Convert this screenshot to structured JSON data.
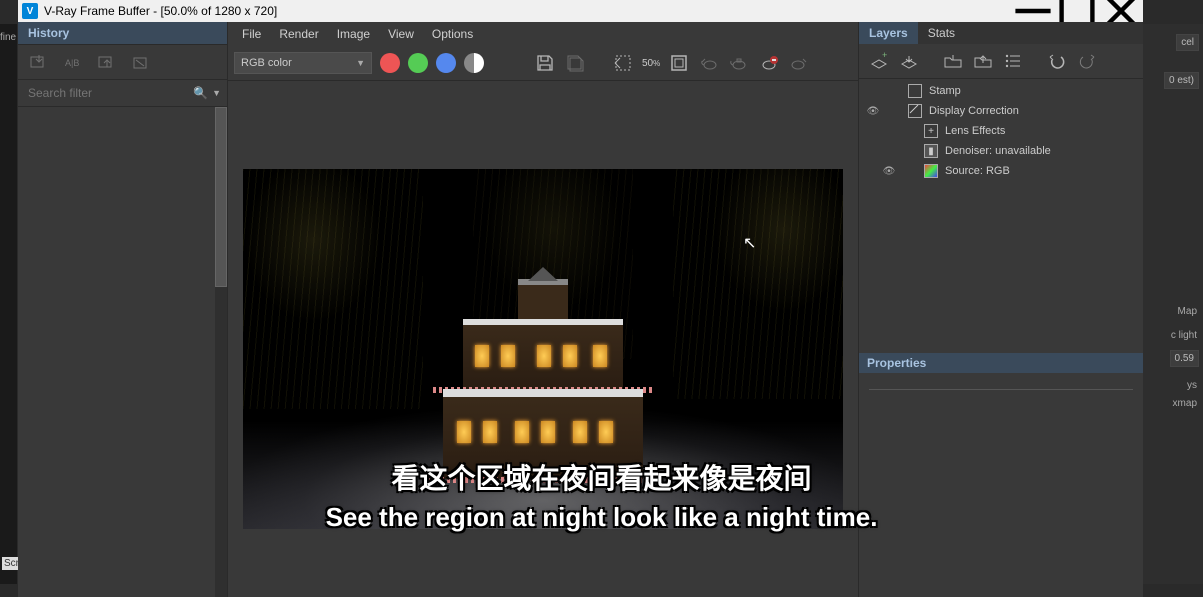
{
  "titlebar": {
    "app_icon_letter": "V",
    "title": "V-Ray Frame Buffer - [50.0% of 1280 x 720]"
  },
  "history": {
    "tab": "History",
    "search_placeholder": "Search filter"
  },
  "menu": {
    "file": "File",
    "render": "Render",
    "image": "Image",
    "view": "View",
    "options": "Options"
  },
  "toolbar": {
    "channel": "RGB color",
    "zoom_pct": "50",
    "zoom_x": "%"
  },
  "layers": {
    "tab_layers": "Layers",
    "tab_stats": "Stats",
    "items": [
      {
        "label": "Stamp"
      },
      {
        "label": "Display Correction"
      },
      {
        "label": "Lens Effects"
      },
      {
        "label": "Denoiser: unavailable"
      },
      {
        "label": "Source: RGB"
      }
    ],
    "properties_hdr": "Properties"
  },
  "bg": {
    "a": "cel",
    "b": "0 est)",
    "c": "Map",
    "d": "c light",
    "e": "0.59",
    "f": "ys",
    "g": "xmap",
    "fine": "fine",
    "scr": "Scr"
  },
  "subtitles": {
    "cn": "看这个区域在夜间看起来像是夜间",
    "en": "See the region at night look like a night time."
  }
}
